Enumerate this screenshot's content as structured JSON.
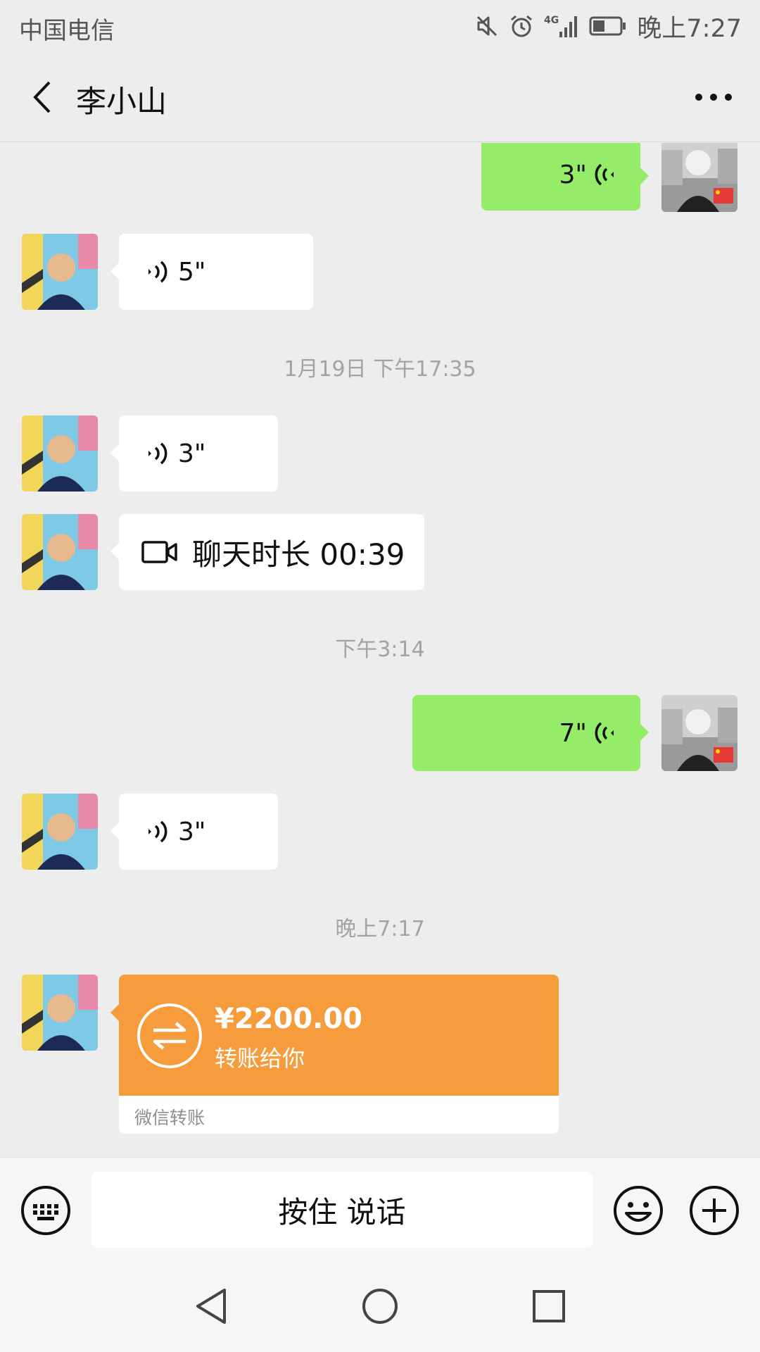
{
  "status_bar": {
    "carrier": "中国电信",
    "time": "晚上7:27",
    "network": "4G",
    "icons": [
      "mute-icon",
      "alarm-icon",
      "signal-icon",
      "battery-icon"
    ]
  },
  "header": {
    "title": "李小山"
  },
  "messages": [
    {
      "side": "right",
      "type": "voice",
      "duration": "3\""
    },
    {
      "side": "left",
      "type": "voice",
      "duration": "5\""
    },
    {
      "type": "timestamp",
      "text": "1月19日 下午17:35"
    },
    {
      "side": "left",
      "type": "voice",
      "duration": "3\""
    },
    {
      "side": "left",
      "type": "video_call",
      "text": "聊天时长 00:39"
    },
    {
      "type": "timestamp",
      "text": "下午3:14"
    },
    {
      "side": "right",
      "type": "voice",
      "duration": "7\""
    },
    {
      "side": "left",
      "type": "voice",
      "duration": "3\""
    },
    {
      "type": "timestamp",
      "text": "晚上7:17"
    },
    {
      "side": "left",
      "type": "transfer",
      "amount": "¥2200.00",
      "desc": "转账给你",
      "label": "微信转账"
    }
  ],
  "input_bar": {
    "hold_to_talk": "按住 说话"
  },
  "colors": {
    "background": "#ededed",
    "bubble_sent": "#95ec69",
    "bubble_received": "#ffffff",
    "transfer": "#f79c3c"
  }
}
